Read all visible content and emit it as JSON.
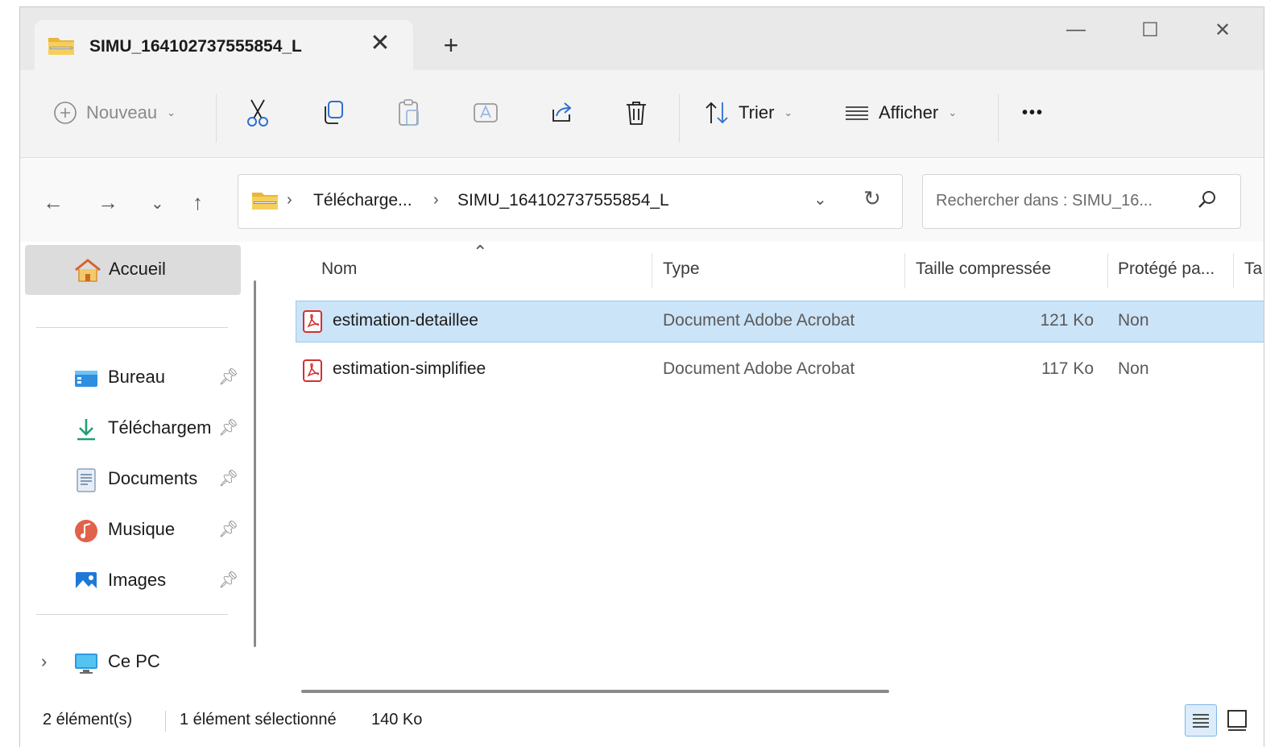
{
  "window": {
    "tab_title": "SIMU_164102737555854_L",
    "tab_close": "✕",
    "new_tab": "+",
    "minimize": "—",
    "maximize": "☐",
    "close": "✕"
  },
  "toolbar": {
    "new_label": "Nouveau",
    "sort_label": "Trier",
    "view_label": "Afficher",
    "more_label": "•••"
  },
  "address": {
    "crumbs": [
      "Télécharge...",
      "SIMU_164102737555854_L"
    ],
    "search_placeholder": "Rechercher dans : SIMU_16..."
  },
  "sidebar": {
    "home": "Accueil",
    "items": [
      {
        "label": "Bureau",
        "icon": "desktop-icon"
      },
      {
        "label": "Téléchargem",
        "icon": "download-icon"
      },
      {
        "label": "Documents",
        "icon": "documents-icon"
      },
      {
        "label": "Musique",
        "icon": "music-icon"
      },
      {
        "label": "Images",
        "icon": "pictures-icon"
      }
    ],
    "this_pc": "Ce PC"
  },
  "columns": [
    "Nom",
    "Type",
    "Taille compressée",
    "Protégé pa...",
    "Ta"
  ],
  "files": [
    {
      "name": "estimation-detaillee",
      "type": "Document Adobe Acrobat",
      "size": "121 Ko",
      "protected": "Non",
      "selected": true
    },
    {
      "name": "estimation-simplifiee",
      "type": "Document Adobe Acrobat",
      "size": "117 Ko",
      "protected": "Non",
      "selected": false
    }
  ],
  "status": {
    "count": "2 élément(s)",
    "selection": "1 élément sélectionné",
    "selection_size": "140 Ko"
  }
}
